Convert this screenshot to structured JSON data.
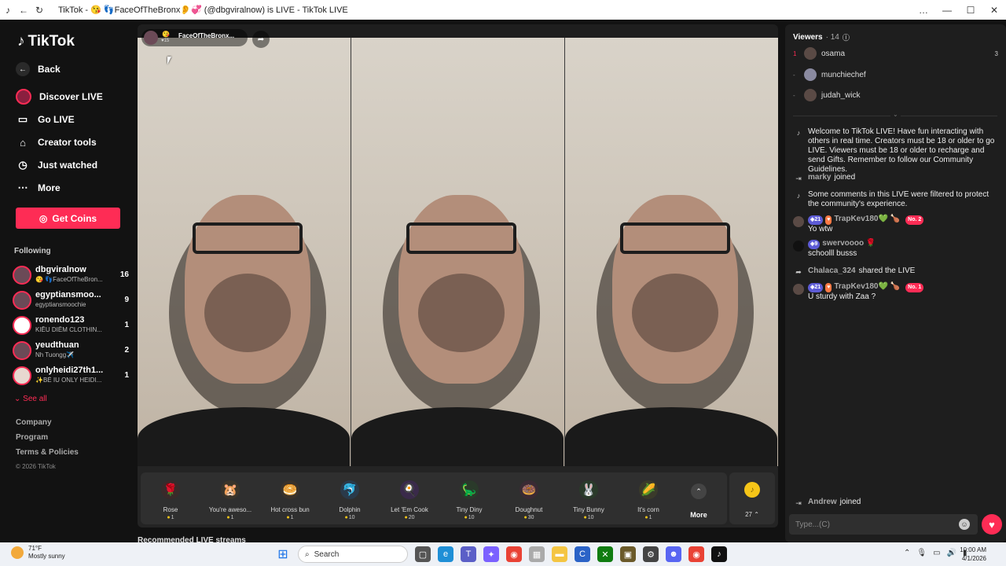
{
  "window": {
    "title": "TikTok - 😘 👣FaceOfTheBronx👂💞 (@dbgviralnow) is LIVE - TikTok LIVE",
    "controls": [
      "…",
      "—",
      "☐",
      "✕"
    ]
  },
  "sidebar": {
    "logo": "TikTok",
    "nav": [
      {
        "label": "Back",
        "icon": "back-arrow-icon"
      },
      {
        "label": "Discover LIVE",
        "icon": "live-avatar-icon"
      },
      {
        "label": "Go LIVE",
        "icon": "camera-icon"
      },
      {
        "label": "Creator tools",
        "icon": "home-icon"
      },
      {
        "label": "Just watched",
        "icon": "history-icon"
      },
      {
        "label": "More",
        "icon": "more-icon"
      }
    ],
    "coins_button": "Get Coins",
    "following_heading": "Following",
    "following": [
      {
        "name": "dbgviralnow",
        "sub": "😘 👣FaceOfTheBron...",
        "count": "16"
      },
      {
        "name": "egyptiansmoo...",
        "sub": "egyptiansmoochie",
        "count": "9"
      },
      {
        "name": "ronendo123",
        "sub": "KIỀU DIỄM CLOTHIN...",
        "count": "1"
      },
      {
        "name": "yeudthuan",
        "sub": "Nh Tuongg✈️",
        "count": "2"
      },
      {
        "name": "onlyheidi27th1...",
        "sub": "✨BÉ IU ONLY HEIDI...",
        "count": "1"
      }
    ],
    "see_all": "See all",
    "footer": [
      "Company",
      "Program",
      "Terms & Policies",
      "© 2026 TikTok"
    ]
  },
  "stage": {
    "host_name": "FaceOfTheBronx...",
    "host_likes": "♥15",
    "host_emoji": "😘",
    "share_icon": "share-icon",
    "below_text": "Recommended LIVE streams"
  },
  "gifts": [
    {
      "name": "Rose",
      "price": "1",
      "icon": "🌹",
      "bg": "#3a2a2a"
    },
    {
      "name": "You're aweso...",
      "price": "1",
      "icon": "🐹",
      "bg": "#3a342a"
    },
    {
      "name": "Hot cross bun",
      "price": "1",
      "icon": "🥯",
      "bg": "#3a322a"
    },
    {
      "name": "Dolphin",
      "price": "10",
      "icon": "🐬",
      "bg": "#2a3a4a"
    },
    {
      "name": "Let 'Em Cook",
      "price": "20",
      "icon": "🍳",
      "bg": "#3a2a4a"
    },
    {
      "name": "Tiny Diny",
      "price": "10",
      "icon": "🦕",
      "bg": "#2a3a2a"
    },
    {
      "name": "Doughnut",
      "price": "30",
      "icon": "🍩",
      "bg": "#3a2a34"
    },
    {
      "name": "Tiny Bunny",
      "price": "10",
      "icon": "🐰",
      "bg": "#2a3a2a"
    },
    {
      "name": "It's corn",
      "price": "1",
      "icon": "🌽",
      "bg": "#3a3a2a"
    }
  ],
  "gift_more": "More",
  "coin_balance": "27 ⌃",
  "chat": {
    "viewers_label": "Viewers",
    "viewers_count": "· 14",
    "viewers": [
      {
        "rank": "1",
        "name": "osama",
        "score": "3"
      },
      {
        "rank": "-",
        "name": "munchiechef",
        "score": ""
      },
      {
        "rank": "-",
        "name": "judah_wick",
        "score": ""
      }
    ],
    "messages": [
      {
        "type": "system",
        "text": "Welcome to TikTok LIVE! Have fun interacting with others in real time. Creators must be 18 or older to go LIVE. Viewers must be 18 or older to recharge and send Gifts. Remember to follow our Community Guidelines."
      },
      {
        "type": "join",
        "user": "marky",
        "text": "joined"
      },
      {
        "type": "system",
        "text": "Some comments in this LIVE were filtered to protect the community's experience."
      },
      {
        "type": "comment",
        "level": "21",
        "user": "TrapKev180💚 🍗",
        "rank": "No. 2",
        "text": "Yo wtw"
      },
      {
        "type": "comment",
        "level": "9",
        "user": "swervoooo 🌹",
        "rank": "",
        "text": "schoolll busss"
      },
      {
        "type": "share",
        "user": "Chalaca_324",
        "text": "shared the LIVE"
      },
      {
        "type": "comment",
        "level": "21",
        "user": "TrapKev180💚 🍗",
        "rank": "No. 1",
        "text": "U sturdy with Zaa ?"
      }
    ],
    "last_join": {
      "user": "Andrew",
      "text": "joined"
    },
    "input_placeholder": "Type...(C)"
  },
  "taskbar": {
    "temp": "71°F",
    "weather": "Mostly sunny",
    "search": "Search",
    "time": "10:00 AM",
    "date": "4/1/2026"
  },
  "colors": {
    "accent": "#fe2c55",
    "bg": "#121212",
    "panel": "#1e1e1e"
  }
}
